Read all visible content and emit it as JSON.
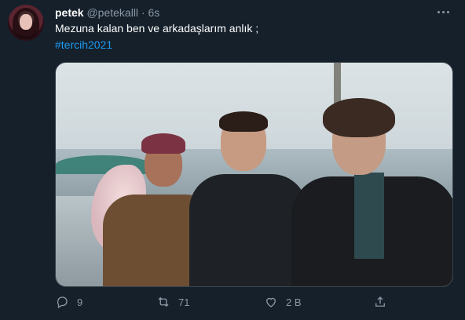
{
  "tweet": {
    "author_name": "petek",
    "author_handle": "@petekalll",
    "separator": "·",
    "time": "6s",
    "text": "Mezuna kalan ben ve arkadaşlarım anlık ;",
    "hashtag": "#tercih2021"
  },
  "actions": {
    "reply_count": "9",
    "retweet_count": "71",
    "like_count": "2 B"
  },
  "icons": {
    "more": "more-horizontal-icon",
    "reply": "reply-icon",
    "retweet": "retweet-icon",
    "like": "heart-icon",
    "share": "share-icon"
  },
  "colors": {
    "background": "#15202b",
    "text": "#ffffff",
    "secondary": "#8b98a5",
    "link": "#1d9bf0"
  }
}
